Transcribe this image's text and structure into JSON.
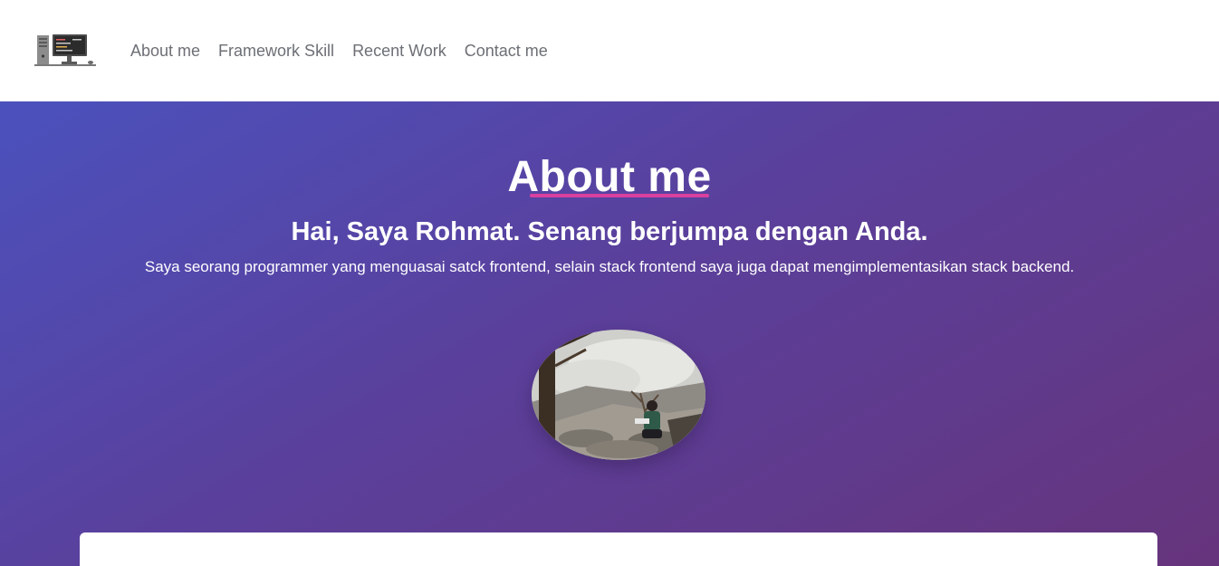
{
  "nav": {
    "logo_icon": "computer-desk-icon",
    "links": [
      {
        "label": "About me"
      },
      {
        "label": "Framework Skill"
      },
      {
        "label": "Recent Work"
      },
      {
        "label": "Contact me"
      }
    ]
  },
  "hero": {
    "title": "About me",
    "subtitle": "Hai, Saya Rohmat. Senang berjumpa dengan Anda.",
    "description": "Saya seorang programmer yang menguasai satck frontend, selain stack frontend saya juga dapat mengimplementasikan stack backend.",
    "photo_icon": "profile-photo"
  },
  "colors": {
    "gradient_start": "#4b51bd",
    "gradient_end": "#66347c",
    "accent_underline": "#d940a0",
    "nav_text": "#6c6f75"
  }
}
